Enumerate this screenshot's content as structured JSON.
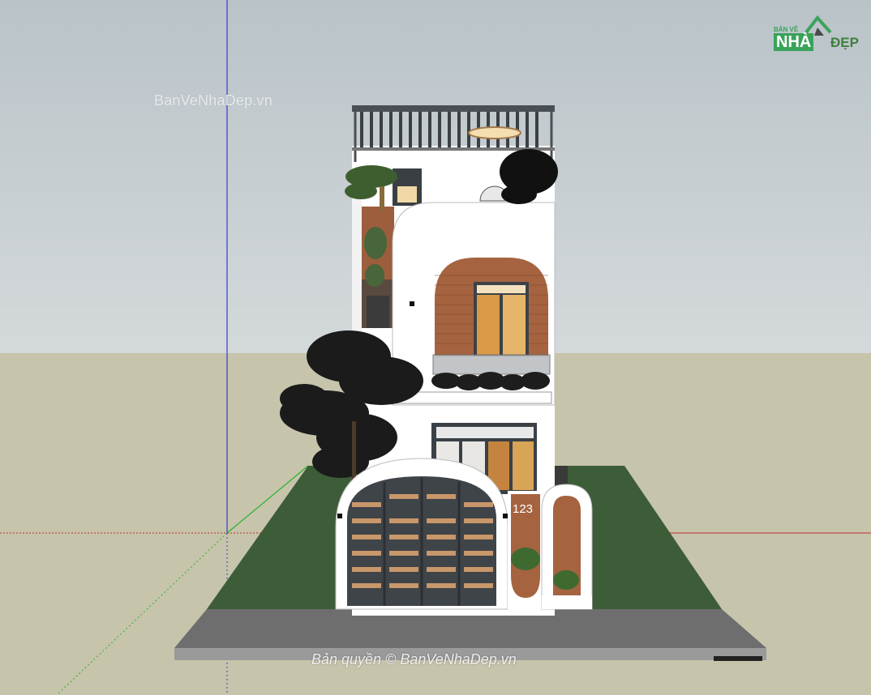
{
  "watermark": "BanVeNhaDep.vn",
  "copyright": "Bản quyền © BanVeNhaDep.vn",
  "house_number": "123",
  "logo": {
    "top": "BẢN VẼ",
    "main": "NHÀ",
    "suffix": "ĐẸP"
  },
  "colors": {
    "sky": "#c9d0d3",
    "ground": "#c6c4ab",
    "lawn": "#3d5c38",
    "road": "#6b6b6b",
    "brick": "#a5633f",
    "wall": "#ffffff",
    "frame": "#4a4f55",
    "axis_red": "#c03030",
    "axis_green": "#2fb02f",
    "axis_blue": "#3a3ad0"
  }
}
